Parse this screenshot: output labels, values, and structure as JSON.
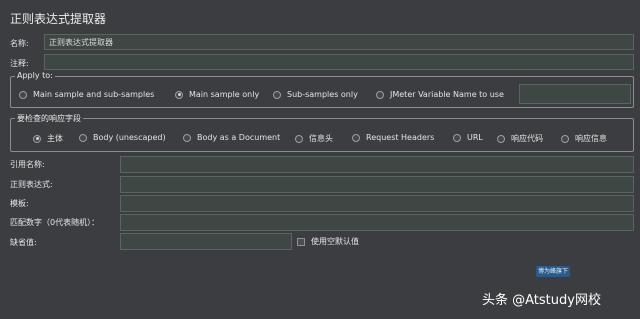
{
  "header": {
    "title": "正则表达式提取器"
  },
  "name_field": {
    "label": "名称:",
    "value": "正则表达式提取器"
  },
  "comment_field": {
    "label": "注释:",
    "value": ""
  },
  "apply_to": {
    "legend": "Apply to:",
    "options": [
      "Main sample and sub-samples",
      "Main sample only",
      "Sub-samples only",
      "JMeter Variable Name to use"
    ],
    "selected": "Main sample only",
    "variable_value": ""
  },
  "response_field": {
    "legend": "要检查的响应字段",
    "options": [
      "主体",
      "Body (unescaped)",
      "Body as a Document",
      "信息头",
      "Request Headers",
      "URL",
      "响应代码",
      "响应信息"
    ],
    "selected": "主体"
  },
  "ref_name": {
    "label": "引用名称:",
    "value": ""
  },
  "regex": {
    "label": "正则表达式:",
    "value": ""
  },
  "template": {
    "label": "模板:",
    "value": ""
  },
  "match_no": {
    "label": "匹配数字（0代表随机）：",
    "value": ""
  },
  "default_value": {
    "label": "缺省值:",
    "value": ""
  },
  "use_empty_default": {
    "label": "使用空默认值",
    "checked": false
  },
  "banner": {
    "text": "博为峰旗下"
  },
  "footer": {
    "text": "头条 @Atstudy网校"
  }
}
